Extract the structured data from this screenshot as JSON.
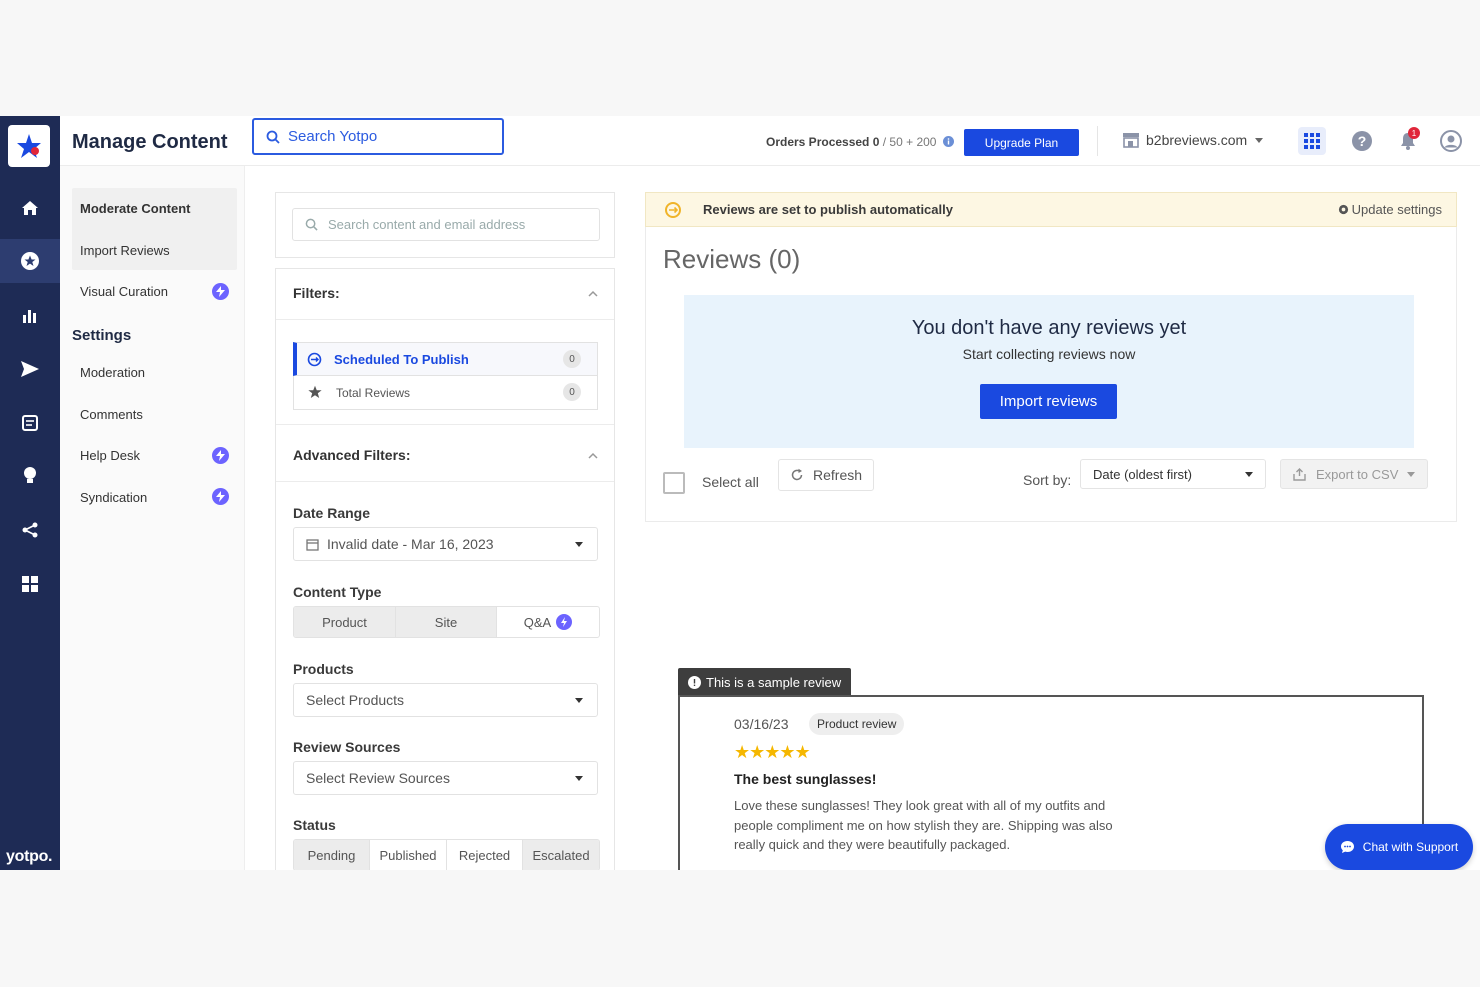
{
  "brand": "yotpo.",
  "header": {
    "title": "Manage Content",
    "search_placeholder": "Search Yotpo",
    "orders_label": "Orders Processed",
    "orders_used": "0",
    "orders_limit": "/ 50 + 200",
    "upgrade_label": "Upgrade Plan",
    "store_name": "b2breviews.com",
    "notification_count": "1"
  },
  "nav": {
    "items": [
      {
        "label": "Moderate Content"
      },
      {
        "label": "Import Reviews"
      },
      {
        "label": "Visual Curation"
      }
    ],
    "settings_title": "Settings",
    "settings_items": [
      {
        "label": "Moderation"
      },
      {
        "label": "Comments"
      },
      {
        "label": "Help Desk"
      },
      {
        "label": "Syndication"
      }
    ]
  },
  "filters": {
    "search_placeholder": "Search content and email address",
    "filters_title": "Filters:",
    "scheduled_label": "Scheduled To Publish",
    "scheduled_count": "0",
    "total_label": "Total Reviews",
    "total_count": "0",
    "advanced_title": "Advanced Filters:",
    "date_range_label": "Date Range",
    "date_range_value": "Invalid date - Mar 16, 2023",
    "content_type_label": "Content Type",
    "content_types": [
      "Product",
      "Site",
      "Q&A"
    ],
    "products_label": "Products",
    "products_placeholder": "Select Products",
    "sources_label": "Review Sources",
    "sources_placeholder": "Select Review Sources",
    "status_label": "Status",
    "statuses": [
      "Pending",
      "Published",
      "Rejected",
      "Escalated"
    ]
  },
  "main": {
    "banner_text": "Reviews are set to publish automatically",
    "update_settings": "Update settings",
    "reviews_title": "Reviews (0)",
    "empty_title": "You don't have any reviews yet",
    "empty_subtitle": "Start collecting reviews now",
    "import_button": "Import reviews",
    "select_all": "Select all",
    "refresh": "Refresh",
    "sort_label": "Sort by:",
    "sort_value": "Date (oldest first)",
    "export": "Export to CSV"
  },
  "sample": {
    "tag": "This is a sample review",
    "date": "03/16/23",
    "type": "Product review",
    "rating": 5,
    "stars": "★★★★★",
    "title": "The best sunglasses!",
    "body": "Love these sunglasses! They look great with all of my outfits and people compliment me on how stylish they are. Shipping was also really quick and they were beautifully packaged."
  },
  "chat_label": "Chat with Support",
  "colors": {
    "primary": "#1a49e0",
    "rail": "#1e2b55",
    "accent": "#6c63ff",
    "star": "#f5b700"
  }
}
